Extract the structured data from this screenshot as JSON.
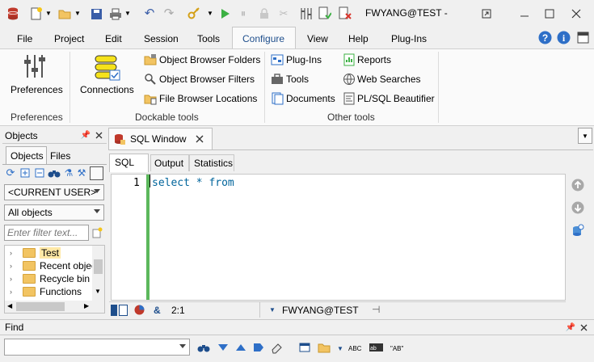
{
  "titlebar": {
    "title": "FWYANG@TEST -"
  },
  "menu": {
    "items": [
      "File",
      "Project",
      "Edit",
      "Session",
      "Tools",
      "Configure",
      "View",
      "Help",
      "Plug-Ins"
    ],
    "active": "Configure"
  },
  "ribbon": {
    "preferences_label": "Preferences",
    "preferences_group": "Preferences",
    "connections_label": "Connections",
    "dockable_group": "Dockable tools",
    "dockable_items": [
      "Object Browser Folders",
      "Object Browser Filters",
      "File Browser Locations"
    ],
    "other_group": "Other tools",
    "other_col1": [
      "Plug-Ins",
      "Tools",
      "Documents"
    ],
    "other_col2": [
      "Reports",
      "Web Searches",
      "PL/SQL Beautifier"
    ]
  },
  "objects_pane": {
    "title": "Objects",
    "tabs": [
      "Objects",
      "Files"
    ],
    "user_combo": "<CURRENT USER>",
    "objects_combo": "All objects",
    "filter_placeholder": "Enter filter text...",
    "tree": [
      "Test",
      "Recent objects",
      "Recycle bin",
      "Functions"
    ]
  },
  "sql_window": {
    "tab_label": "SQL Window",
    "subtabs": [
      "SQL",
      "Output",
      "Statistics"
    ],
    "line_number": "1",
    "code": "select * from",
    "status_position": "2:1",
    "status_connection": "FWYANG@TEST"
  },
  "find_bar": {
    "title": "Find",
    "value": ""
  },
  "colors": {
    "accent_green": "#5cb85c",
    "code_blue": "#00649b",
    "connections_yellow": "#f5e21b"
  }
}
